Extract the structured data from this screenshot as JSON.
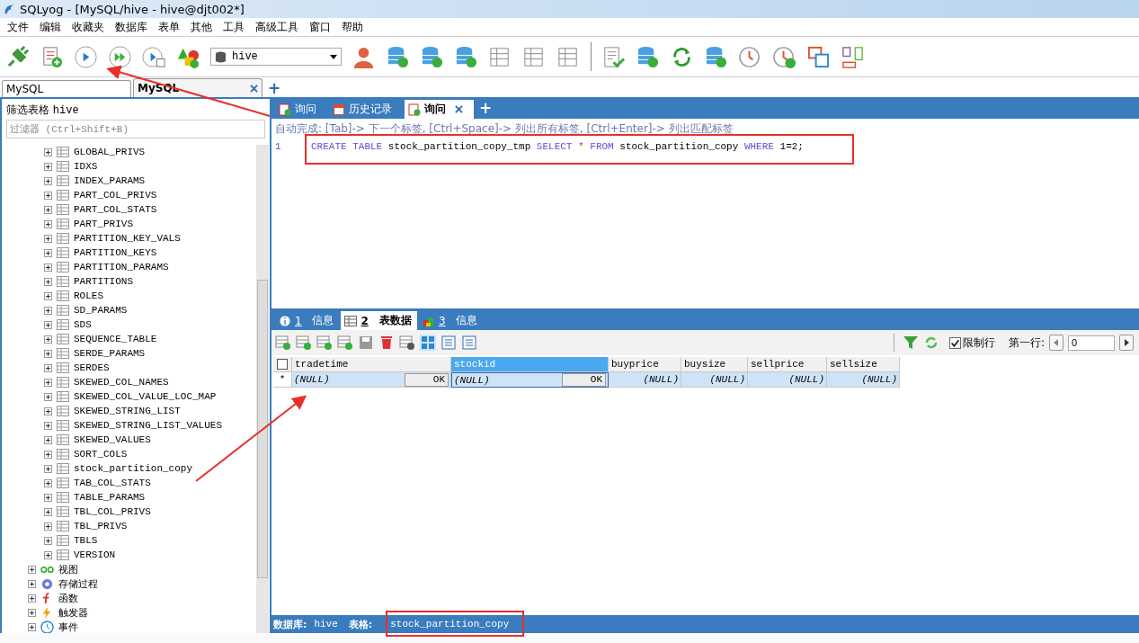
{
  "window": {
    "title": "SQLyog - [MySQL/hive - hive@djt002*]"
  },
  "menu": [
    "文件",
    "编辑",
    "收藏夹",
    "数据库",
    "表单",
    "其他",
    "工具",
    "高级工具",
    "窗口",
    "帮助"
  ],
  "toolbar": {
    "database": "hive"
  },
  "connection_tabs": [
    {
      "label": "MySQL",
      "selected": false,
      "closable": false
    },
    {
      "label": "MySQL",
      "selected": true,
      "closable": true
    }
  ],
  "connection_tab_add": "+",
  "sidebar": {
    "title": "筛选表格",
    "database": "hive",
    "filter_placeholder": "过滤器 (Ctrl+Shift+B)",
    "tables": [
      {
        "label": "GLOBAL_PRIVS",
        "expanded": false
      },
      {
        "label": "IDXS",
        "expanded": false
      },
      {
        "label": "INDEX_PARAMS",
        "expanded": false
      },
      {
        "label": "PART_COL_PRIVS",
        "expanded": false
      },
      {
        "label": "PART_COL_STATS",
        "expanded": false
      },
      {
        "label": "PART_PRIVS",
        "expanded": false
      },
      {
        "label": "PARTITION_KEY_VALS",
        "expanded": false
      },
      {
        "label": "PARTITION_KEYS",
        "expanded": false
      },
      {
        "label": "PARTITION_PARAMS",
        "expanded": false
      },
      {
        "label": "PARTITIONS",
        "expanded": false
      },
      {
        "label": "ROLES",
        "expanded": false
      },
      {
        "label": "SD_PARAMS",
        "expanded": false
      },
      {
        "label": "SDS",
        "expanded": false
      },
      {
        "label": "SEQUENCE_TABLE",
        "expanded": false
      },
      {
        "label": "SERDE_PARAMS",
        "expanded": false
      },
      {
        "label": "SERDES",
        "expanded": false
      },
      {
        "label": "SKEWED_COL_NAMES",
        "expanded": false
      },
      {
        "label": "SKEWED_COL_VALUE_LOC_MAP",
        "expanded": false
      },
      {
        "label": "SKEWED_STRING_LIST",
        "expanded": false
      },
      {
        "label": "SKEWED_STRING_LIST_VALUES",
        "expanded": false
      },
      {
        "label": "SKEWED_VALUES",
        "expanded": false
      },
      {
        "label": "SORT_COLS",
        "expanded": false
      },
      {
        "label": "stock_partition_copy",
        "expanded": false
      },
      {
        "label": "TAB_COL_STATS",
        "expanded": false
      },
      {
        "label": "TABLE_PARAMS",
        "expanded": false
      },
      {
        "label": "TBL_COL_PRIVS",
        "expanded": false
      },
      {
        "label": "TBL_PRIVS",
        "expanded": false
      },
      {
        "label": "TBLS",
        "expanded": false
      },
      {
        "label": "VERSION",
        "expanded": false
      }
    ],
    "folders": [
      {
        "label": "视图",
        "kind": "views",
        "expanded": false
      },
      {
        "label": "存储过程",
        "kind": "procedures",
        "expanded": false
      },
      {
        "label": "函数",
        "kind": "functions",
        "expanded": false
      },
      {
        "label": "触发器",
        "kind": "triggers",
        "expanded": false
      },
      {
        "label": "事件",
        "kind": "events",
        "expanded": false
      }
    ]
  },
  "query_tabs": [
    {
      "label": "询问",
      "kind": "query",
      "selected": false,
      "closable": false
    },
    {
      "label": "历史记录",
      "kind": "history",
      "selected": false,
      "closable": false
    },
    {
      "label": "询问",
      "kind": "query",
      "selected": true,
      "closable": true
    }
  ],
  "query_tab_add": "+",
  "editor": {
    "hint": "自动完成: [Tab]-> 下一个标签, [Ctrl+Space]-> 列出所有标签, [Ctrl+Enter]-> 列出匹配标签",
    "lines": [
      {
        "number": "1",
        "tokens": [
          {
            "text": "CREATE TABLE",
            "kind": "keyword"
          },
          {
            "text": "stock_partition_copy_tmp",
            "kind": "ident"
          },
          {
            "text": "SELECT",
            "kind": "keyword"
          },
          {
            "text": "*",
            "kind": "operator"
          },
          {
            "text": "FROM",
            "kind": "keyword"
          },
          {
            "text": "stock_partition_copy",
            "kind": "ident"
          },
          {
            "text": "WHERE",
            "kind": "keyword"
          },
          {
            "text": "1=2;",
            "kind": "ident"
          }
        ]
      }
    ]
  },
  "result_tabs": [
    {
      "number": "1",
      "label": "信息",
      "kind": "info",
      "selected": false
    },
    {
      "number": "2",
      "label": "表数据",
      "kind": "table",
      "selected": true
    },
    {
      "number": "3",
      "label": "信息",
      "kind": "profile",
      "selected": false
    }
  ],
  "result_toolbar": {
    "limit_rows": {
      "label": "限制行",
      "checked": true
    },
    "first_row_label": "第一行:",
    "first_row": "0"
  },
  "table": {
    "select_all": {
      "checked": false
    },
    "columns": [
      {
        "label": "tradetime",
        "selected": false
      },
      {
        "label": "stockid",
        "selected": true
      },
      {
        "label": "buyprice",
        "selected": false
      },
      {
        "label": "buysize",
        "selected": false
      },
      {
        "label": "sellprice",
        "selected": false
      },
      {
        "label": "sellsize",
        "selected": false
      }
    ],
    "rows": [
      {
        "marker": "*",
        "selected": true,
        "cells": [
          {
            "value": "(NULL)",
            "button": "OK"
          },
          {
            "value": "(NULL)",
            "button": "OK"
          },
          {
            "value": "(NULL)"
          },
          {
            "value": "(NULL)"
          },
          {
            "value": "(NULL)"
          },
          {
            "value": "(NULL)"
          }
        ]
      }
    ]
  },
  "status_bar": {
    "database_label": "数据库:",
    "database": "hive",
    "table_label": "表格:",
    "table": "stock_partition_copy"
  }
}
